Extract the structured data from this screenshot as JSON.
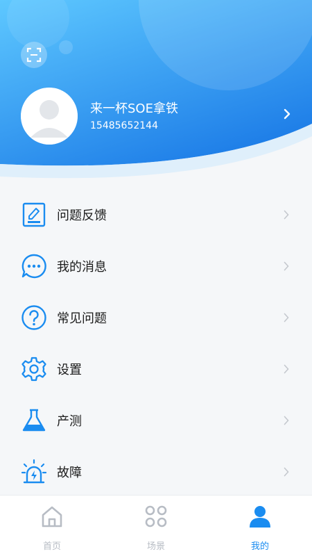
{
  "profile": {
    "name": "来一杯SOE拿铁",
    "id": "15485652144"
  },
  "menu": {
    "items": [
      {
        "label": "问题反馈",
        "icon": "feedback-edit-icon"
      },
      {
        "label": "我的消息",
        "icon": "message-bubble-icon"
      },
      {
        "label": "常见问题",
        "icon": "question-circle-icon"
      },
      {
        "label": "设置",
        "icon": "gear-icon"
      },
      {
        "label": "产测",
        "icon": "flask-icon"
      },
      {
        "label": "故障",
        "icon": "alarm-icon"
      }
    ]
  },
  "tabbar": {
    "tabs": [
      {
        "label": "首页",
        "icon": "home-icon",
        "active": false
      },
      {
        "label": "场景",
        "icon": "scene-grid-icon",
        "active": false
      },
      {
        "label": "我的",
        "icon": "user-icon",
        "active": true
      }
    ]
  },
  "colors": {
    "accent": "#1a8cf0",
    "header_gradient_start": "#5ec8ff",
    "header_gradient_end": "#1f7fe8",
    "inactive": "#b7bcc4"
  }
}
